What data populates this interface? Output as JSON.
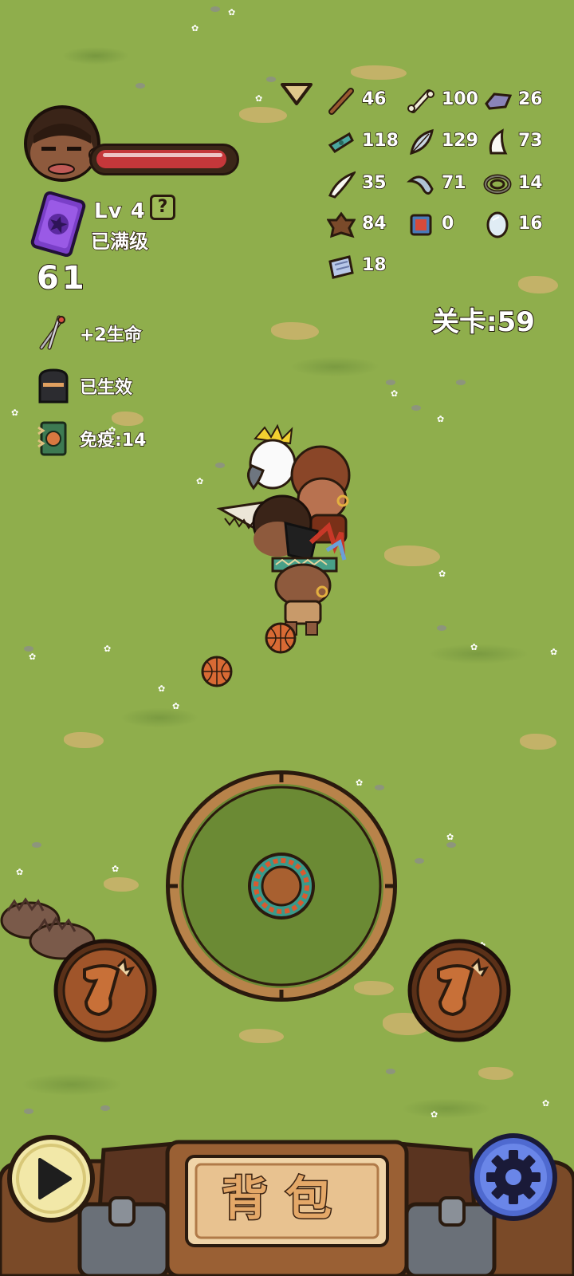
{
  "player": {
    "level_label": "Lv 4",
    "level_help": "?",
    "level_status": "已满级",
    "score": "61",
    "hp_percent": 96
  },
  "buffs": [
    {
      "icon": "needles-icon",
      "label": "+2生命"
    },
    {
      "icon": "tombstone-icon",
      "label": "已生效"
    },
    {
      "icon": "shield-book-icon",
      "label": "免疫:14"
    }
  ],
  "resources": [
    {
      "icon": "stick-icon",
      "count": "46"
    },
    {
      "icon": "bone-icon",
      "count": "100"
    },
    {
      "icon": "iron-ingot-icon",
      "count": "26"
    },
    {
      "icon": "leaf-icon",
      "count": "118"
    },
    {
      "icon": "feather-icon",
      "count": "129"
    },
    {
      "icon": "tooth-icon",
      "count": "73"
    },
    {
      "icon": "horn-icon",
      "count": "35"
    },
    {
      "icon": "claw-icon",
      "count": "71"
    },
    {
      "icon": "rope-icon",
      "count": "14"
    },
    {
      "icon": "hide-icon",
      "count": "84"
    },
    {
      "icon": "chip-icon",
      "count": "0"
    },
    {
      "icon": "mirror-icon",
      "count": "16"
    },
    {
      "icon": "scroll-icon",
      "count": "18"
    }
  ],
  "stage": {
    "label": "关卡:",
    "value": "59"
  },
  "bottom": {
    "bag_label": "背包"
  },
  "colors": {
    "grass": "#8fae4c",
    "hp": "#c4373a",
    "wood": "#8a5a33",
    "gear": "#4f6ad0"
  }
}
